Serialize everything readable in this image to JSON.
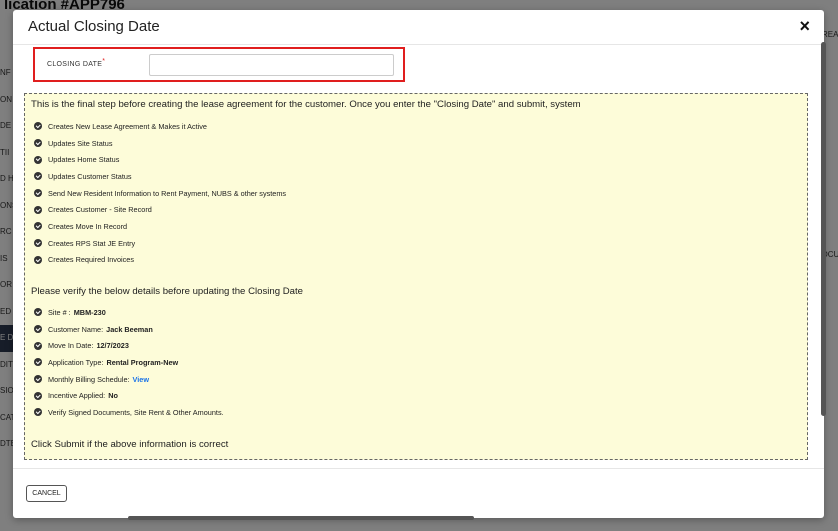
{
  "background": {
    "page_title": "lication #APP796",
    "left_fragments": [
      "NF",
      "ON",
      "DE",
      "TII",
      "D H",
      "ONS",
      "RC",
      "IS",
      "OR",
      "ED",
      "E D",
      "DIT",
      "SIO",
      "CAT",
      "DTE"
    ],
    "right_fragments": [
      "REA",
      "DCU"
    ]
  },
  "modal": {
    "title": "Actual Closing Date",
    "close_glyph": "×",
    "closing_date": {
      "label": "CLOSING DATE",
      "required_marker": "*",
      "value": "",
      "placeholder": ""
    },
    "intro": "This is the final step before creating the lease agreement for the customer. Once you enter the \"Closing Date\" and submit, system",
    "steps": [
      "Creates New Lease Agreement & Makes it Active",
      "Updates Site Status",
      "Updates Home Status",
      "Updates Customer Status",
      "Send New Resident Information to Rent Payment, NUBS & other systems",
      "Creates Customer - Site Record",
      "Creates Move In Record",
      "Creates RPS Stat JE Entry",
      "Creates Required Invoices"
    ],
    "verify_heading": "Please verify the below details before updating the Closing Date",
    "details": [
      {
        "label": "Site # :",
        "value": "MBM-230"
      },
      {
        "label": "Customer Name:",
        "value": "Jack Beeman"
      },
      {
        "label": "Move In Date:",
        "value": "12/7/2023"
      },
      {
        "label": "Application Type:",
        "value": "Rental Program-New"
      },
      {
        "label": "Monthly Billing Schedule:",
        "value": "View"
      },
      {
        "label": "Incentive Applied:",
        "value": "No"
      },
      {
        "label": "Verify Signed Documents, Site Rent & Other Amounts.",
        "value": ""
      }
    ],
    "submit_note": "Click Submit if the above information is correct",
    "cancel_label": "CANCEL"
  },
  "colors": {
    "required": "#e01e1e",
    "panel_bg": "#fdfcd9",
    "link": "#1a73e8"
  }
}
